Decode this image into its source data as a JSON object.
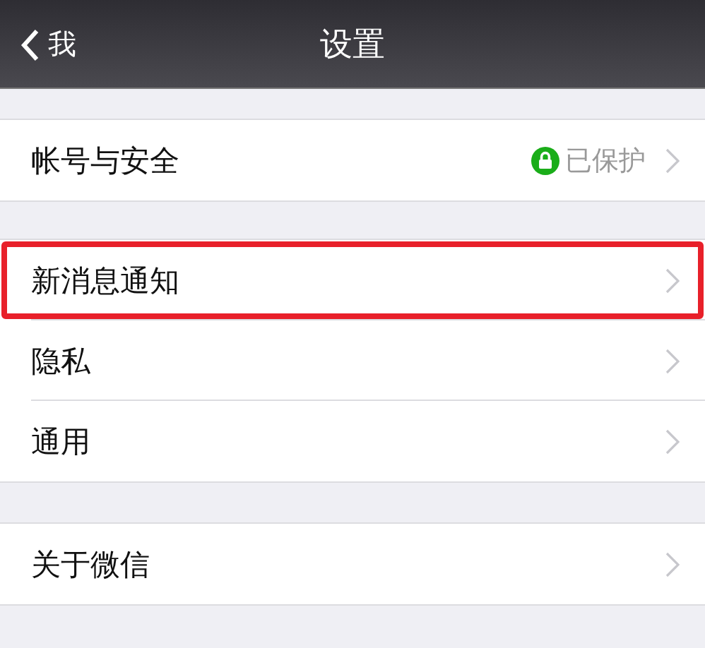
{
  "nav_bar": {
    "back_label": "我",
    "title": "设置"
  },
  "groups": [
    {
      "items": [
        {
          "label": "帐号与安全",
          "status": "已保护",
          "highlighted": false
        }
      ]
    },
    {
      "items": [
        {
          "label": "新消息通知",
          "highlighted": true
        },
        {
          "label": "隐私",
          "highlighted": false
        },
        {
          "label": "通用",
          "highlighted": false
        }
      ]
    },
    {
      "items": [
        {
          "label": "关于微信",
          "highlighted": false
        }
      ]
    }
  ]
}
